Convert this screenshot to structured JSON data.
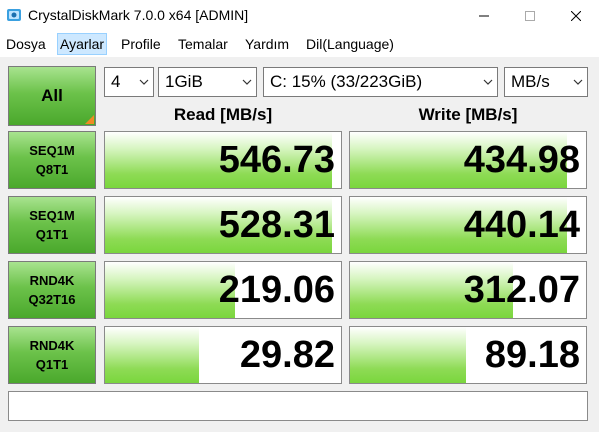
{
  "window": {
    "title": "CrystalDiskMark 7.0.0 x64 [ADMIN]"
  },
  "menu": [
    "Dosya",
    "Ayarlar",
    "Profile",
    "Temalar",
    "Yardım",
    "Dil(Language)"
  ],
  "controls": {
    "all_label": "All",
    "count": "4",
    "size": "1GiB",
    "drive": "C: 15% (33/223GiB)",
    "unit": "MB/s"
  },
  "columns": {
    "read": "Read [MB/s]",
    "write": "Write [MB/s]"
  },
  "tests": [
    {
      "line1": "SEQ1M",
      "line2": "Q8T1",
      "read": "546.73",
      "write": "434.98",
      "read_fill": 0.96,
      "write_fill": 0.92
    },
    {
      "line1": "SEQ1M",
      "line2": "Q1T1",
      "read": "528.31",
      "write": "440.14",
      "read_fill": 0.96,
      "write_fill": 0.92
    },
    {
      "line1": "RND4K",
      "line2": "Q32T16",
      "read": "219.06",
      "write": "312.07",
      "read_fill": 0.55,
      "write_fill": 0.69
    },
    {
      "line1": "RND4K",
      "line2": "Q1T1",
      "read": "29.82",
      "write": "89.18",
      "read_fill": 0.4,
      "write_fill": 0.49
    }
  ],
  "status_text": ""
}
